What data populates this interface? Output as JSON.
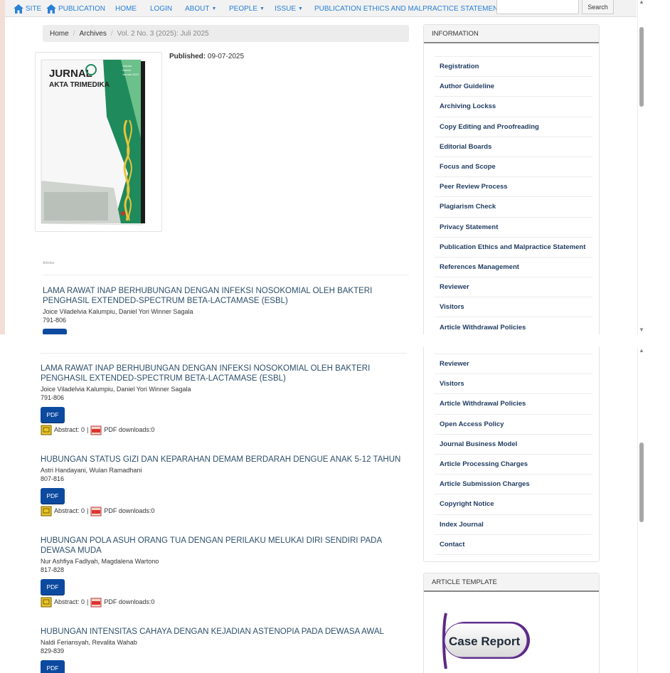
{
  "nav": {
    "items": [
      {
        "label": "SITE",
        "icon": "home-icon"
      },
      {
        "label": "PUBLICATION",
        "icon": "home-icon"
      },
      {
        "label": "HOME"
      },
      {
        "label": "LOGIN"
      },
      {
        "label": "ABOUT",
        "dropdown": true
      },
      {
        "label": "PEOPLE",
        "dropdown": true
      },
      {
        "label": "ISSUE",
        "dropdown": true
      },
      {
        "label": "PUBLICATION ETHICS AND MALPRACTICE STATEMENT"
      }
    ],
    "search_value": "",
    "search_button": "Search"
  },
  "breadcrumb": {
    "home": "Home",
    "archives": "Archives",
    "current": "Vol. 2 No. 3 (2025): Juli 2025"
  },
  "issue": {
    "published_label": "Published:",
    "published_date": "09-07-2025",
    "cover": {
      "title_line1": "JURNAL",
      "title_line2": "AKTA TRIMEDIKA",
      "side_line1": "Volume",
      "side_line2": "Nomor",
      "side_line3": "Januari 2024"
    },
    "section_label": "Articles"
  },
  "articles": [
    {
      "title": "LAMA RAWAT INAP BERHUBUNGAN DENGAN INFEKSI NOSOKOMIAL OLEH BAKTERI PENGHASIL EXTENDED-SPECTRUM BETA-LACTAMASE (ESBL)",
      "authors": "Joice Viladelvia Kalumpiu, Daniel Yori Winner Sagala",
      "pages": "791-806",
      "pdf": "PDF",
      "abstract_label": "Abstract: 0",
      "downloads_label": "PDF downloads:0"
    },
    {
      "title": "HUBUNGAN STATUS GIZI DAN KEPARAHAN DEMAM BERDARAH DENGUE ANAK 5-12 TAHUN",
      "authors": "Astri Handayani, Wulan Ramadhani",
      "pages": "807-816",
      "pdf": "PDF",
      "abstract_label": "Abstract: 0",
      "downloads_label": "PDF downloads:0"
    },
    {
      "title": "HUBUNGAN POLA ASUH ORANG TUA DENGAN PERILAKU MELUKAI DIRI SENDIRI PADA DEWASA MUDA",
      "authors": "Nur Ashfiya Fadlyah, Magdalena Wartono",
      "pages": "817-828",
      "pdf": "PDF",
      "abstract_label": "Abstract: 0",
      "downloads_label": "PDF downloads:0"
    },
    {
      "title": "HUBUNGAN INTENSITAS CAHAYA DENGAN KEJADIAN ASTENOPIA PADA DEWASA AWAL",
      "authors": "Naldi Feriansyah, Revalita Wahab",
      "pages": "829-839",
      "pdf": "PDF"
    }
  ],
  "sidebar": {
    "info_heading": "INFORMATION",
    "info_items": [
      "Registration",
      "Author Guideline",
      "Archiving Lockss",
      "Copy Editing and Proofreading",
      "Editorial Boards",
      "Focus and Scope",
      "Peer Review Process",
      "Plagiarism Check",
      "Privacy Statement",
      "Publication Ethics and Malpractice Statement",
      "References Management",
      "Reviewer",
      "Visitors",
      "Article Withdrawal Policies",
      "Open Access Policy",
      "Journal Business Model",
      "Article Processing Charges",
      "Article Submission Charges",
      "Copyright Notice",
      "Index Journal",
      "Contact"
    ],
    "template_heading": "ARTICLE TEMPLATE",
    "template_banner": "Case Report"
  },
  "colors": {
    "nav_link": "#2a7fd6",
    "article_title": "#2d4f6b",
    "sidebar_link": "#1e3a5f",
    "pdf_button": "#0c4aa0"
  }
}
